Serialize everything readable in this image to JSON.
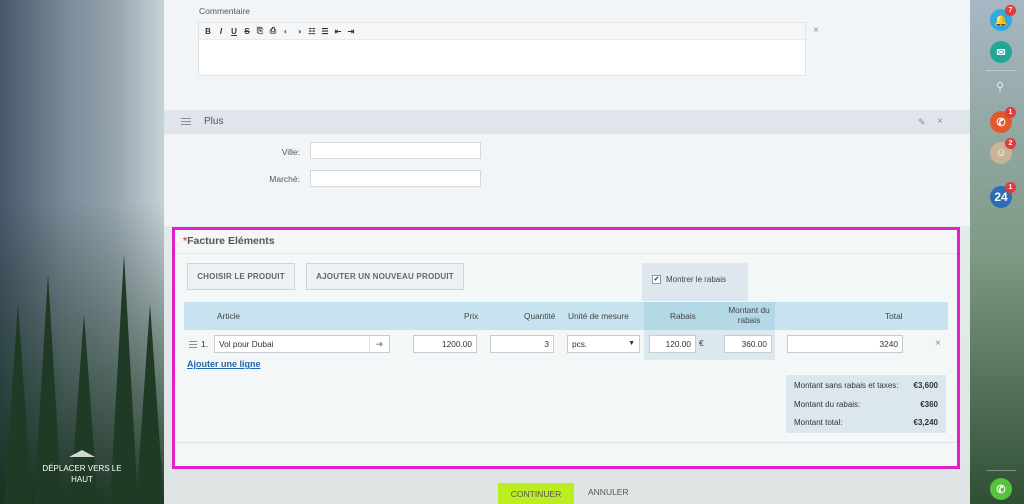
{
  "comment": {
    "label": "Commentaire",
    "toolbar": [
      "B",
      "I",
      "U",
      "S",
      "⎘",
      "⎙",
      "◐",
      "◑",
      "☷",
      "☰",
      "⇤",
      "⇥"
    ]
  },
  "plus": {
    "title": "Plus"
  },
  "fields": {
    "ville_label": "Ville:",
    "marche_label": "Marché:"
  },
  "facture": {
    "title": "Facture Eléments",
    "choose_product": "CHOISIR LE PRODUIT",
    "add_new_product": "AJOUTER UN NOUVEAU PRODUIT",
    "show_discount": "Montrer le rabais",
    "headers": {
      "article": "Article",
      "prix": "Prix",
      "quantite": "Quantité",
      "unite": "Unité de mesure",
      "rabais": "Rabais",
      "montant_rabais": "Montant du rabais",
      "total": "Total"
    },
    "row": {
      "index": "1.",
      "article": "Vol pour Dubai",
      "prix": "1200.00",
      "quantite": "3",
      "unite": "pcs.",
      "rabais": "120.00",
      "currency": "€",
      "montant_rabais": "360.00",
      "total": "3240"
    },
    "add_line": "Ajouter une ligne",
    "totals": [
      {
        "label": "Montant sans rabais et taxes:",
        "value": "€3,600"
      },
      {
        "label": "Montant du rabais:",
        "value": "€360"
      },
      {
        "label": "Montant total:",
        "value": "€3,240"
      }
    ]
  },
  "actions": {
    "continue": "CONTINUER",
    "cancel": "ANNULER"
  },
  "sidebar": {
    "move_up": "DÉPLACER VERS LE HAUT"
  },
  "rightbar": {
    "notifications_badge": "7",
    "phone_badge": "1",
    "chat_badge": "2",
    "b24_label": "24",
    "b24_badge": "1"
  },
  "colors": {
    "highlight_border": "#e020c8",
    "continue_btn": "#bbed21",
    "link": "#2067b0",
    "table_header": "#c6e3ef"
  }
}
